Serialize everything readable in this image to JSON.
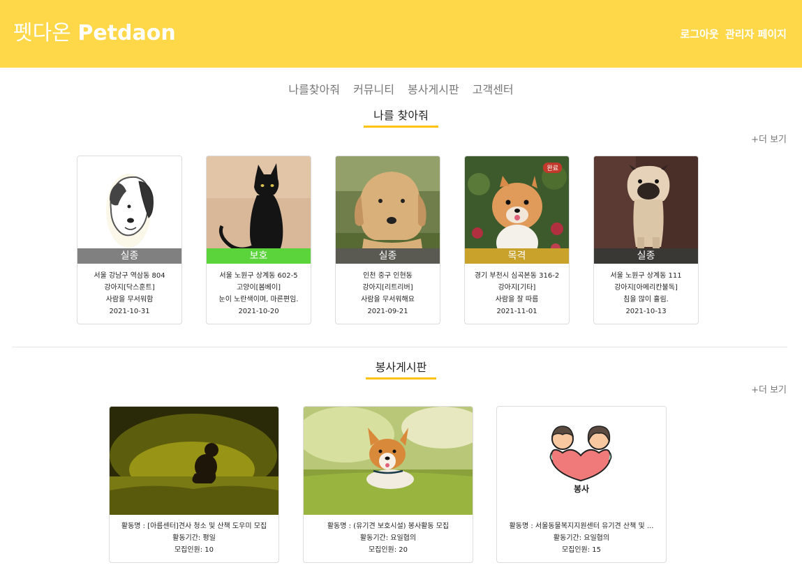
{
  "header": {
    "logo_kr": "펫다온",
    "logo_en": "Petdaon",
    "logout": "로그아웃",
    "admin": "관리자 페이지",
    "bg_color": "#FFD84A"
  },
  "nav": [
    "나를찾아줘",
    "커뮤니티",
    "봉사게시판",
    "고객센터"
  ],
  "find_me": {
    "title": "나를 찾아줘",
    "more": "+더 보기",
    "cards": [
      {
        "status": "실종",
        "status_color": "#808080",
        "location": "서울 강남구 역삼동 804",
        "species": "강아지[닥스훈트]",
        "desc": "사람을 무서워함",
        "date": "2021-10-31",
        "image": "dog-sketch"
      },
      {
        "status": "보호",
        "status_color": "#5BD33A",
        "location": "서울 노원구 상계동 602-5",
        "species": "고양이[봄베이]",
        "desc": "눈이 노란색이며, 마른편임.",
        "date": "2021-10-20",
        "image": "black-cat"
      },
      {
        "status": "실종",
        "status_color": "#5a5a52",
        "location": "인천 중구 인현동",
        "species": "강아지[리트리버]",
        "desc": "사람을 무서워해요",
        "date": "2021-09-21",
        "image": "golden-retriever"
      },
      {
        "status": "목격",
        "status_color": "#C8A22A",
        "badge": "완료",
        "location": "경기 부천시 심곡본동 316-2",
        "species": "강아지[기타]",
        "desc": "사람을 잘 따름",
        "date": "2021-11-01",
        "image": "pomeranian"
      },
      {
        "status": "실종",
        "status_color": "#3a3835",
        "location": "서울 노원구 상계동 111",
        "species": "강아지[아메리칸불독]",
        "desc": "침을 많이 흘림.",
        "date": "2021-10-13",
        "image": "pug"
      }
    ]
  },
  "volunteer": {
    "title": "봉사게시판",
    "more": "+더 보기",
    "cards": [
      {
        "name": "활동명 : [아름센터]견사 청소 및 산책 도우미 모집",
        "period": "활동기간: 평일",
        "people": "모집인원: 10",
        "image": "dog-silhouette-field"
      },
      {
        "name": "활동명 : (유기견 보호시설) 봉사활동 모집",
        "period": "활동기간: 요일협의",
        "people": "모집인원: 20",
        "image": "corgi-grass"
      },
      {
        "name": "활동명 : 서울동물복지지원센터 유기견 산책 및 ...",
        "period": "활동기간: 요일협의",
        "people": "모집인원: 15",
        "image": "volunteer-heart",
        "image_text": "봉사"
      }
    ]
  }
}
